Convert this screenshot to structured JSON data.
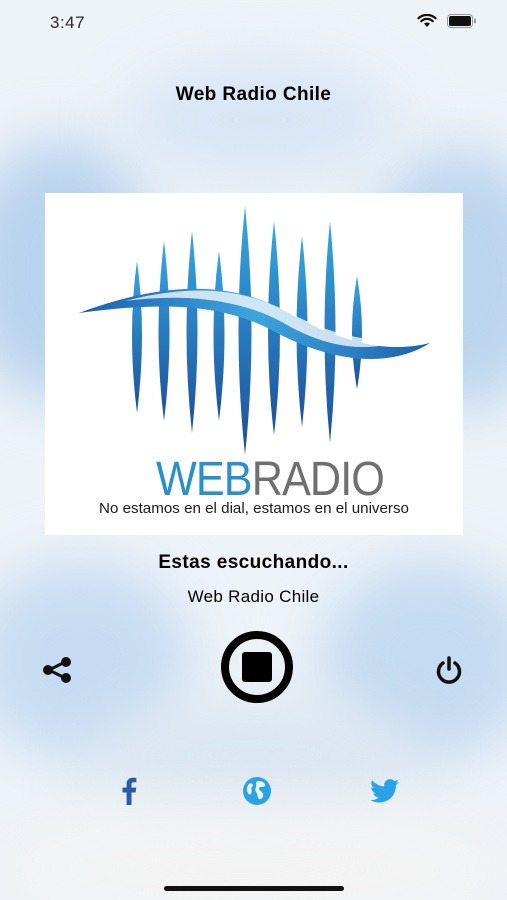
{
  "status_bar": {
    "time": "3:47",
    "icons": [
      "wifi-icon",
      "battery-icon"
    ]
  },
  "app": {
    "title": "Web Radio Chile"
  },
  "logo": {
    "brand_web": "WEB",
    "brand_radio": "RADIO",
    "tagline": "No estamos en el dial, estamos en el universo"
  },
  "player": {
    "now_playing_label": "Estas escuchando...",
    "station_name": "Web Radio Chile",
    "state": "playing",
    "controls": [
      "share-icon",
      "stop-icon",
      "power-icon"
    ]
  },
  "social": {
    "icons": [
      "facebook-icon",
      "globe-icon",
      "twitter-icon"
    ]
  },
  "colors": {
    "accent_blue": "#2b8fc9",
    "dark_blue": "#1b4f9c",
    "facebook": "#2b5aa6",
    "twitter": "#2ba1e6",
    "text": "#000000"
  }
}
